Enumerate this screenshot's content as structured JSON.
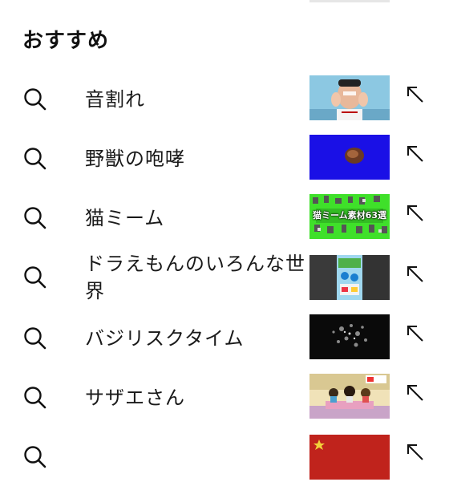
{
  "header": {
    "title": "おすすめ"
  },
  "suggestions": [
    {
      "label": "音割れ",
      "icon": "search-icon",
      "thumbnail": "man-face-thumbnail",
      "action_icon": "insert-arrow-icon"
    },
    {
      "label": "野獣の咆哮",
      "icon": "search-icon",
      "thumbnail": "blue-screen-thumbnail",
      "action_icon": "insert-arrow-icon"
    },
    {
      "label": "猫ミーム",
      "icon": "search-icon",
      "thumbnail": "green-screen-cats-thumbnail",
      "thumbnail_text": "猫ミーム素材63選",
      "action_icon": "insert-arrow-icon"
    },
    {
      "label": "ドラえもんのいろんな世界",
      "icon": "search-icon",
      "thumbnail": "doraemon-thumbnail",
      "action_icon": "insert-arrow-icon"
    },
    {
      "label": "バジリスクタイム",
      "icon": "search-icon",
      "thumbnail": "dark-scene-thumbnail",
      "action_icon": "insert-arrow-icon"
    },
    {
      "label": "サザエさん",
      "icon": "search-icon",
      "thumbnail": "sazae-family-thumbnail",
      "action_icon": "insert-arrow-icon"
    }
  ],
  "colors": {
    "text": "#1a1a1a",
    "icon": "#111111",
    "blue_thumb": "#1a10e6",
    "green_thumb": "#3fe02a",
    "dark_thumb": "#0a0a0a",
    "partial_thumb": "#c0231c"
  }
}
